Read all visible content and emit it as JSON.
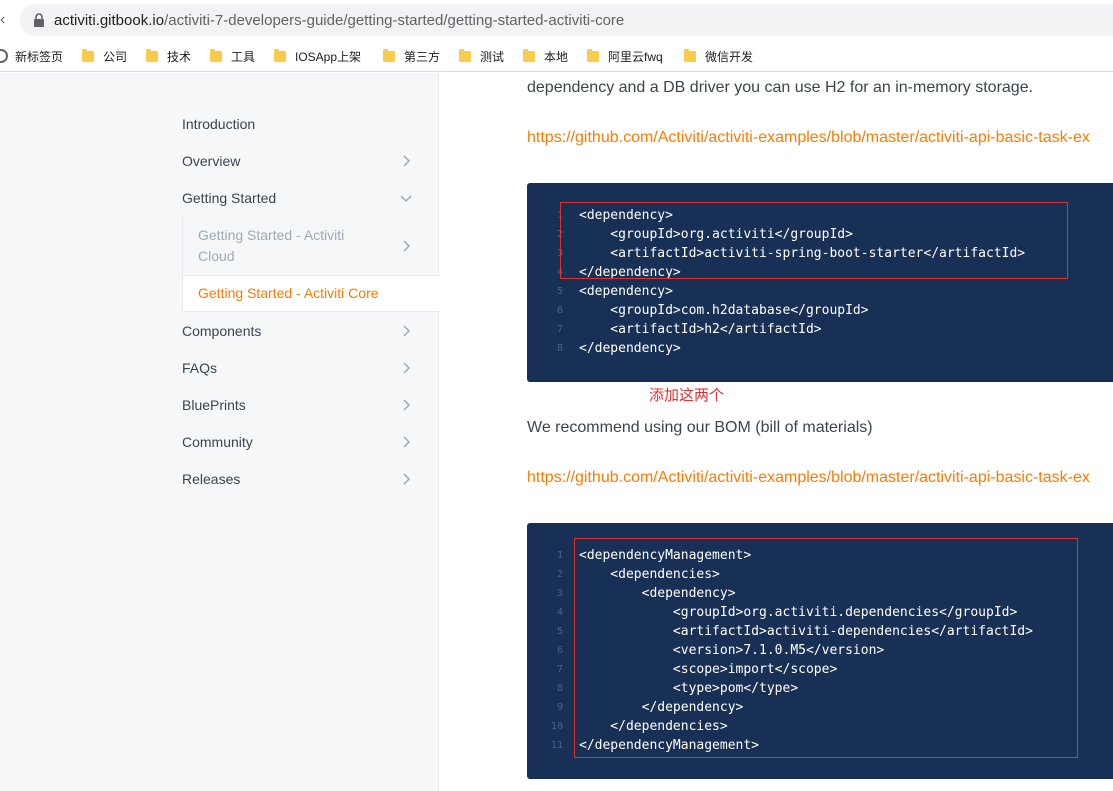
{
  "browser": {
    "url_host": "activiti.gitbook.io",
    "url_path": "/activiti-7-developers-guide/getting-started/getting-started-activiti-core",
    "bookmarks": [
      {
        "label": "新标签页",
        "icon": "globe-icon"
      },
      {
        "label": "公司",
        "icon": "folder-icon"
      },
      {
        "label": "技术",
        "icon": "folder-icon"
      },
      {
        "label": "工具",
        "icon": "folder-icon"
      },
      {
        "label": "IOSApp上架",
        "icon": "folder-icon"
      },
      {
        "label": "第三方",
        "icon": "folder-icon"
      },
      {
        "label": "测试",
        "icon": "folder-icon"
      },
      {
        "label": "本地",
        "icon": "folder-icon"
      },
      {
        "label": "阿里云fwq",
        "icon": "folder-icon"
      },
      {
        "label": "微信开发",
        "icon": "folder-icon"
      }
    ]
  },
  "sidebar": {
    "items": [
      {
        "label": "Introduction"
      },
      {
        "label": "Overview"
      },
      {
        "label": "Getting Started"
      },
      {
        "label": "Getting Started - Activiti Cloud"
      },
      {
        "label": "Getting Started - Activiti Core"
      },
      {
        "label": "Components"
      },
      {
        "label": "FAQs"
      },
      {
        "label": "BluePrints"
      },
      {
        "label": "Community"
      },
      {
        "label": "Releases"
      }
    ],
    "sub_cloud_line1": "Getting Started - Activiti",
    "sub_cloud_line2": "Cloud"
  },
  "content": {
    "para1": "dependency and a DB driver you can use H2 for an in-memory storage.",
    "link1": "https://github.com/Activiti/activiti-examples/blob/master/activiti-api-basic-task-ex",
    "code1": [
      {
        "n": "1",
        "text": "<dependency>"
      },
      {
        "n": "2",
        "text": "    <groupId>org.activiti</groupId>"
      },
      {
        "n": "3",
        "text": "    <artifactId>activiti-spring-boot-starter</artifactId>"
      },
      {
        "n": "4",
        "text": "</dependency>"
      },
      {
        "n": "5",
        "text": "<dependency>"
      },
      {
        "n": "6",
        "text": "    <groupId>com.h2database</groupId>"
      },
      {
        "n": "7",
        "text": "    <artifactId>h2</artifactId>"
      },
      {
        "n": "8",
        "text": "</dependency>"
      }
    ],
    "annotation": "添加这两个",
    "para2": "We recommend using our BOM (bill of materials)",
    "link2": "https://github.com/Activiti/activiti-examples/blob/master/activiti-api-basic-task-ex",
    "code2": [
      {
        "n": "1",
        "text": "<dependencyManagement>"
      },
      {
        "n": "2",
        "text": "    <dependencies>"
      },
      {
        "n": "3",
        "text": "        <dependency>"
      },
      {
        "n": "4",
        "text": "            <groupId>org.activiti.dependencies</groupId>"
      },
      {
        "n": "5",
        "text": "            <artifactId>activiti-dependencies</artifactId>"
      },
      {
        "n": "6",
        "text": "            <version>7.1.0.M5</version>"
      },
      {
        "n": "7",
        "text": "            <scope>import</scope>"
      },
      {
        "n": "8",
        "text": "            <type>pom</type>"
      },
      {
        "n": "9",
        "text": "        </dependency>"
      },
      {
        "n": "10",
        "text": "    </dependencies>"
      },
      {
        "n": "11",
        "text": "</dependencyManagement>"
      }
    ]
  }
}
